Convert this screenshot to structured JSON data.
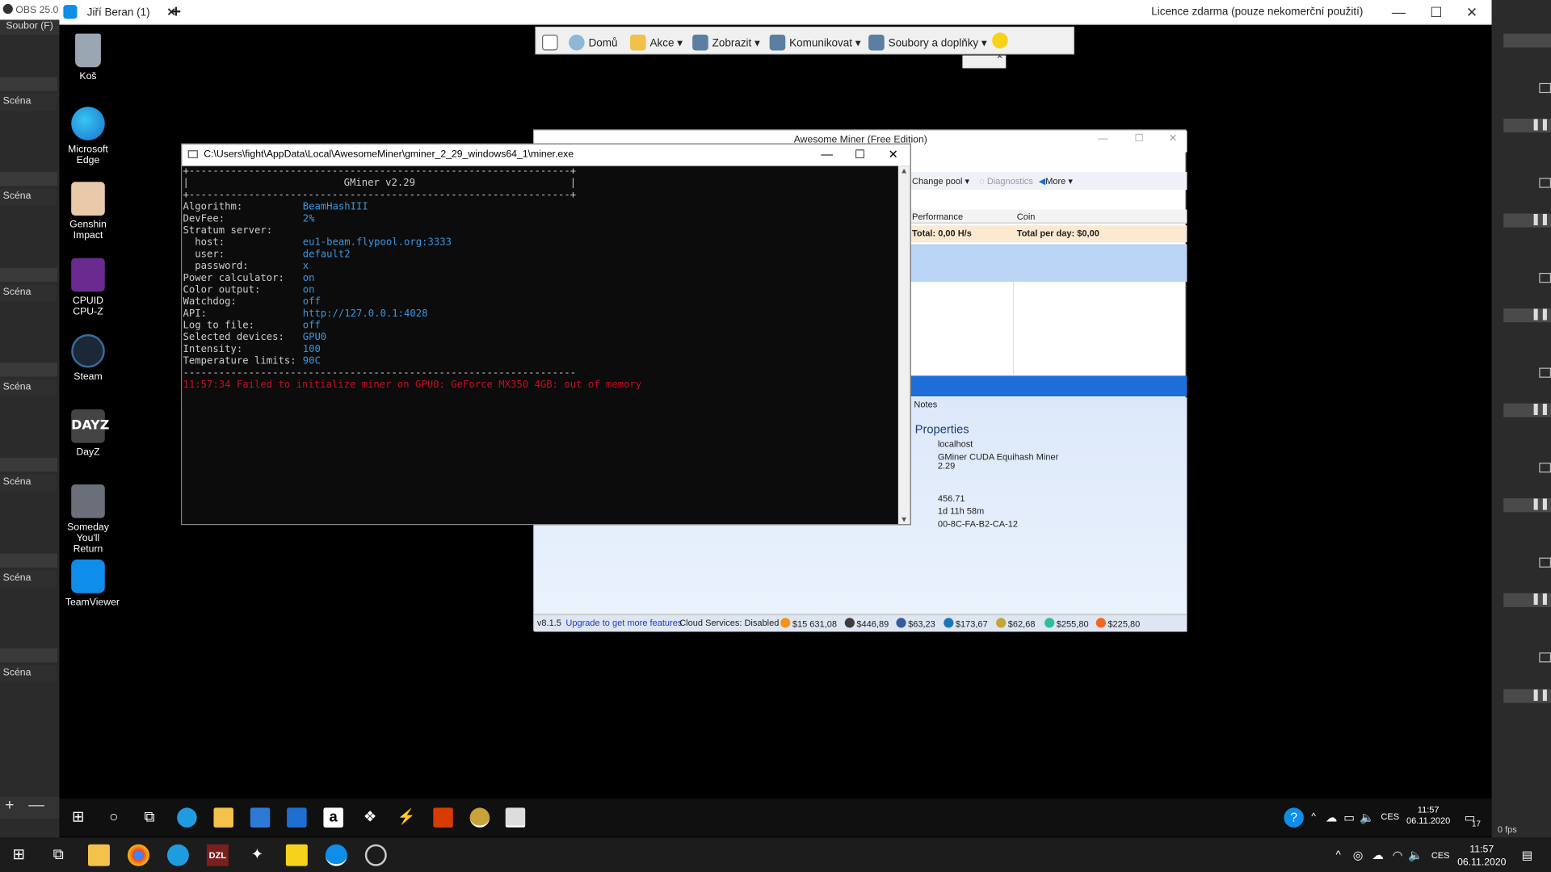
{
  "obs": {
    "title": "OBS 25.0",
    "menu": "Soubor (F)",
    "scene_label": "Scéna",
    "fps_text": "0 fps",
    "add_label": "+",
    "remove_label": "—"
  },
  "teamviewer": {
    "tab_title": "Jiří Beran (1)",
    "license_text": "Licence zdarma (pouze nekomerční použití)",
    "toolbar": {
      "home": "Domů",
      "actions": "Akce",
      "view": "Zobrazit",
      "communicate": "Komunikovat",
      "files": "Soubory a doplňky"
    }
  },
  "desktop_icons": [
    {
      "label": "Koš",
      "icon": "recycle-bin-icon",
      "color": "#9aa6b2"
    },
    {
      "label": "Microsoft Edge",
      "icon": "edge-icon",
      "color": "#1f9ce0"
    },
    {
      "label": "Genshin Impact",
      "icon": "genshin-icon",
      "color": "#e9c9a9"
    },
    {
      "label": "CPUID CPU-Z",
      "icon": "cpuz-icon",
      "color": "#6a2a90"
    },
    {
      "label": "Steam",
      "icon": "steam-icon",
      "color": "#1b2838"
    },
    {
      "label": "DayZ",
      "icon": "dayz-icon",
      "color": "#444444"
    },
    {
      "label": "Someday You'll Return",
      "icon": "someday-icon",
      "color": "#6b6f7a"
    },
    {
      "label": "TeamViewer",
      "icon": "teamviewer-icon",
      "color": "#0e8ee9"
    }
  ],
  "awesome_miner": {
    "title": "Awesome Miner (Free Edition)",
    "toolbar": {
      "change_pool": "Change pool",
      "diagnostics": "Diagnostics",
      "more": "More"
    },
    "columns": {
      "performance": "Performance",
      "coin": "Coin"
    },
    "totals": {
      "total": "Total: 0,00 H/s",
      "per_day": "Total per day: $0,00"
    },
    "notes_tab": "Notes",
    "properties": {
      "heading": "Properties",
      "host": "localhost",
      "miner": "GMiner CUDA Equihash Miner",
      "version": "2.29",
      "value1": "456.71",
      "uptime": "1d 11h 58m",
      "mac": "00-8C-FA-B2-CA-12"
    },
    "status": {
      "version": "v8.1.5",
      "upgrade": "Upgrade to get more features",
      "cloud": "Cloud Services: Disabled",
      "prices": [
        {
          "value": "$15 631,08",
          "color": "#f7931a"
        },
        {
          "value": "$446,89",
          "color": "#3c3c3d"
        },
        {
          "value": "$63,23",
          "color": "#345d9d"
        },
        {
          "value": "$173,67",
          "color": "#1c75bc"
        },
        {
          "value": "$62,68",
          "color": "#c3a634"
        },
        {
          "value": "$255,80",
          "color": "#2cbf9a"
        },
        {
          "value": "$225,80",
          "color": "#f26822"
        }
      ]
    }
  },
  "console": {
    "title": "C:\\Users\\fight\\AppData\\Local\\AwesomeMiner\\gminer_2_29_windows64_1\\miner.exe",
    "border_line": "+----------------------------------------------------------------+",
    "header": "|                          GMiner v2.29                          |",
    "rows": [
      {
        "key": "Algorithm:",
        "value": "BeamHashIII"
      },
      {
        "key": "DevFee:",
        "value": "2%"
      },
      {
        "key": "Stratum server:",
        "value": ""
      },
      {
        "key": "  host:",
        "value": "eu1-beam.flypool.org:3333"
      },
      {
        "key": "  user:",
        "value": "default2"
      },
      {
        "key": "  password:",
        "value": "x"
      },
      {
        "key": "Power calculator:",
        "value": "on"
      },
      {
        "key": "Color output:",
        "value": "on"
      },
      {
        "key": "Watchdog:",
        "value": "off"
      },
      {
        "key": "API:",
        "value": "http://127.0.0.1:4028"
      },
      {
        "key": "Log to file:",
        "value": "off"
      },
      {
        "key": "Selected devices:",
        "value": "GPU0"
      },
      {
        "key": "Intensity:",
        "value": "100"
      },
      {
        "key": "Temperature limits:",
        "value": "90C"
      }
    ],
    "separator": "------------------------------------------------------------------",
    "error": "11:57:34 Failed to initialize miner on GPU0: GeForce MX350 4GB: out of memory"
  },
  "inner_taskbar": {
    "lang": "CES",
    "time": "11:57",
    "date": "06.11.2020",
    "notif_count": "17"
  },
  "outer_taskbar": {
    "lang": "CES",
    "time": "11:57",
    "date": "06.11.2020"
  }
}
